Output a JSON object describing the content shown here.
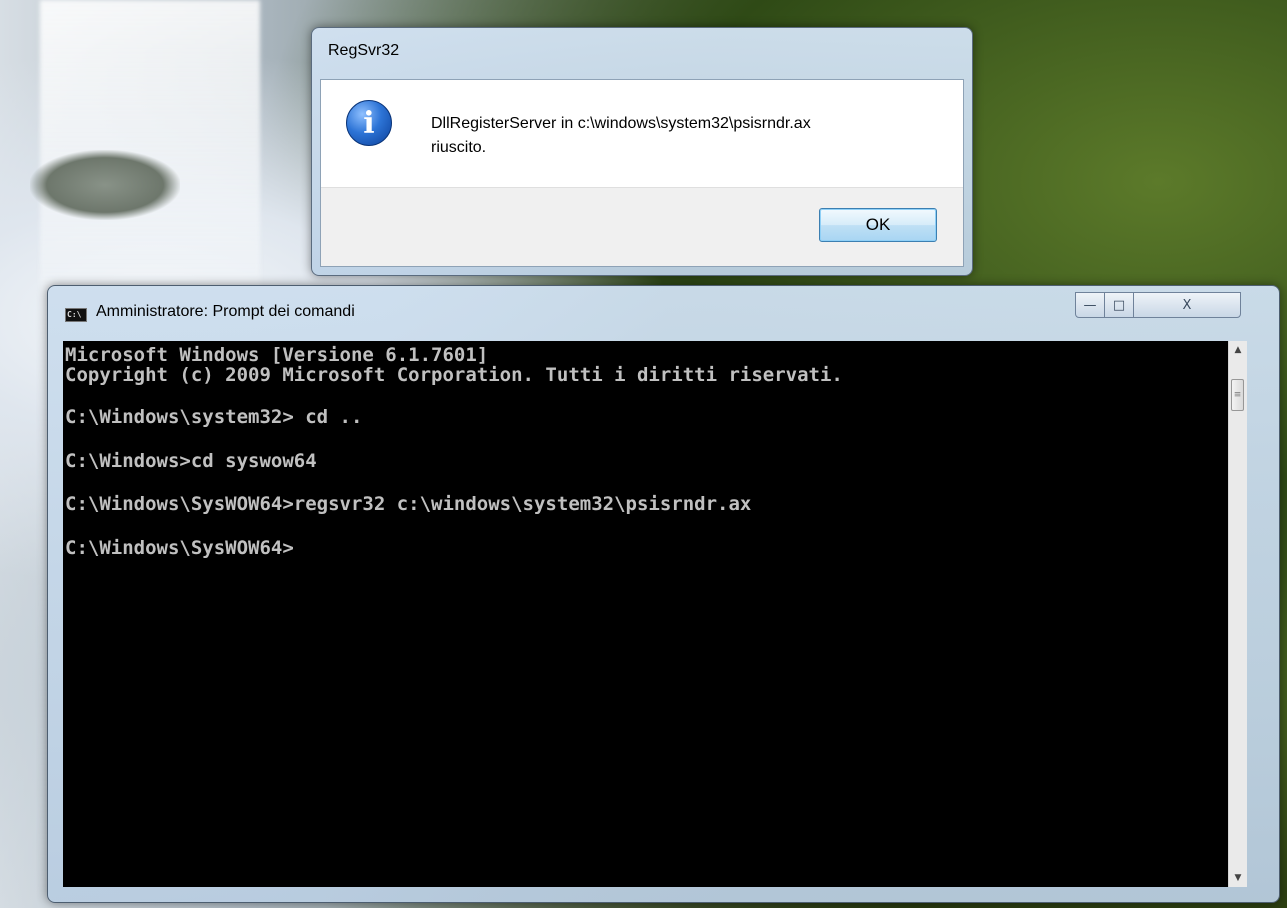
{
  "dialog": {
    "title": "RegSvr32",
    "message_line1": "DllRegisterServer in c:\\windows\\system32\\psisrndr.ax",
    "message_line2": "riuscito.",
    "ok_label": "OK",
    "icon": "info-icon",
    "icon_glyph": "i"
  },
  "console": {
    "title": "Amministratore: Prompt dei comandi",
    "icon_glyph": "C:\\",
    "buttons": {
      "minimize": "—",
      "maximize": "□",
      "close": "X"
    },
    "lines": [
      "Microsoft Windows [Versione 6.1.7601]",
      "Copyright (c) 2009 Microsoft Corporation. Tutti i diritti riservati.",
      "C:\\Windows\\system32> cd ..",
      "C:\\Windows>cd syswow64",
      "C:\\Windows\\SysWOW64>regsvr32 c:\\windows\\system32\\psisrndr.ax",
      "C:\\Windows\\SysWOW64>"
    ],
    "scroll_up": "▲",
    "scroll_down": "▼",
    "scroll_thumb_grip": "≡"
  }
}
